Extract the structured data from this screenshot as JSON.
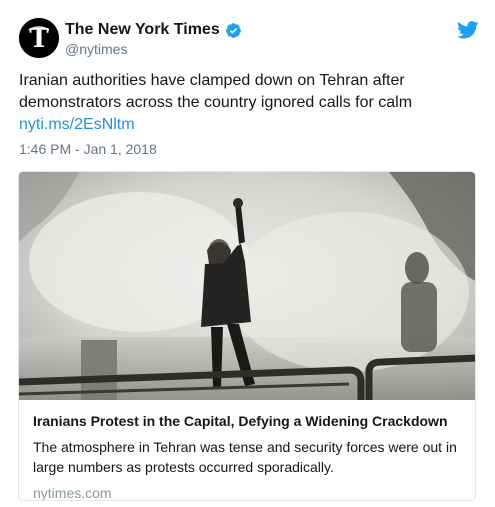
{
  "author": {
    "display_name": "The New York Times",
    "handle": "@nytimes",
    "avatar_icon": "nyt-logo-icon",
    "verified_icon": "verified-badge-icon",
    "brand_icon": "twitter-bird-icon"
  },
  "tweet": {
    "text": "Iranian authorities have clamped down on Tehran after demonstrators across the country ignored calls for calm",
    "link": "nyti.ms/2EsNltm",
    "timestamp": "1:46 PM - Jan 1, 2018"
  },
  "card": {
    "image_icon": "protest-photo",
    "title": "Iranians Protest in the Capital, Defying a Widening Crackdown",
    "description": "The atmosphere in Tehran was tense and security forces were out in large numbers as protests occurred sporadically.",
    "domain": "nytimes.com"
  },
  "colors": {
    "link": "#1b95e0",
    "verified": "#1da1f2",
    "twitter_blue": "#1da1f2",
    "secondary_text": "#657786",
    "border": "#e1e8ed"
  }
}
